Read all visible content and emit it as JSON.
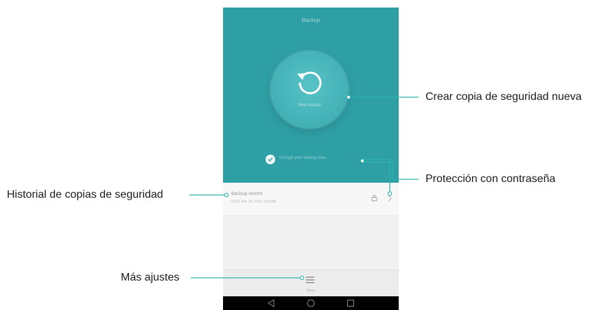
{
  "app": {
    "title": "Backup",
    "new_backup_label": "New backup",
    "encrypt_label": "Encrypt your backup data",
    "record": {
      "title": "Backup record",
      "date": "NEXT Nov 05, 2015, 3:56 AM"
    },
    "menu_label": "Menu"
  },
  "callouts": {
    "new_backup": "Crear copia de seguridad nueva",
    "password": "Protección con contraseña",
    "history": "Historial de copias de seguridad",
    "more": "Más ajustes"
  },
  "colors": {
    "teal": "#2f9fa6",
    "leader": "#2fb3ad"
  },
  "icons": [
    "refresh-icon",
    "checkmark-icon",
    "lock-icon",
    "chevron-right-icon",
    "menu-icon",
    "back-icon",
    "home-icon",
    "recents-icon"
  ]
}
